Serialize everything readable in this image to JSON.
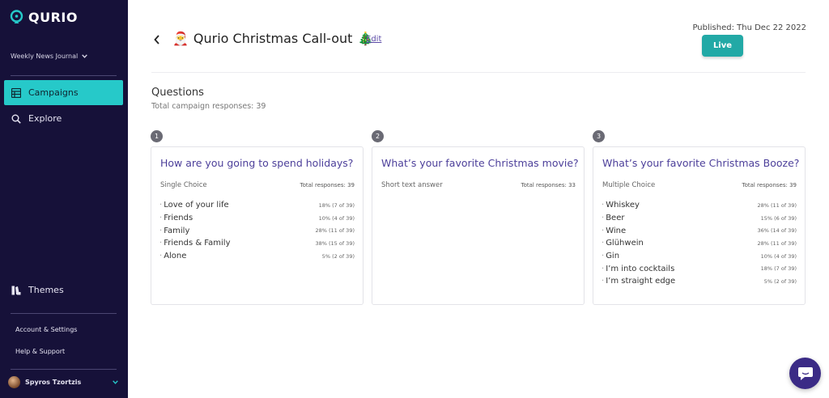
{
  "brand": {
    "name": "QURIO",
    "accent": "#26c9c9",
    "sidebar_bg": "#161139"
  },
  "sidebar": {
    "workspace": "Weekly News Journal",
    "nav": [
      {
        "label": "Campaigns",
        "icon": "table-icon",
        "active": true
      },
      {
        "label": "Explore",
        "icon": "search-icon",
        "active": false
      },
      {
        "label": "Themes",
        "icon": "themes-icon",
        "active": false
      }
    ],
    "account_link": "Account & Settings",
    "help_link": "Help & Support",
    "user_name": "Spyros Tzortzis"
  },
  "header": {
    "title": "Qurio Christmas Call-out",
    "title_prefix_emoji": "🎅",
    "title_suffix_emoji": "🎄",
    "edit_label": "Edit",
    "published": "Published: Thu Dec 22 2022",
    "live_label": "Live"
  },
  "questions": {
    "heading": "Questions",
    "subtitle": "Total campaign responses: 39",
    "cards": [
      {
        "number": "1",
        "title": "How are you going to spend holidays?",
        "type": "Single Choice",
        "total": "Total responses: 39",
        "answers": [
          {
            "label": "Love of your life",
            "pct": "18% (7 of 39)"
          },
          {
            "label": "Friends",
            "pct": "10% (4 of 39)"
          },
          {
            "label": "Family",
            "pct": "28% (11 of 39)"
          },
          {
            "label": "Friends & Family",
            "pct": "38% (15 of 39)"
          },
          {
            "label": "Alone",
            "pct": "5% (2 of 39)"
          }
        ]
      },
      {
        "number": "2",
        "title": "What’s your favorite Christmas movie?",
        "type": "Short text answer",
        "total": "Total responses: 33",
        "answers": []
      },
      {
        "number": "3",
        "title": "What’s your favorite Christmas Booze?",
        "type": "Multiple Choice",
        "total": "Total responses: 39",
        "answers": [
          {
            "label": "Whiskey",
            "pct": "28% (11 of 39)"
          },
          {
            "label": "Beer",
            "pct": "15% (6 of 39)"
          },
          {
            "label": "Wine",
            "pct": "36% (14 of 39)"
          },
          {
            "label": "Glühwein",
            "pct": "28% (11 of 39)"
          },
          {
            "label": "Gin",
            "pct": "10% (4 of 39)"
          },
          {
            "label": "I’m into cocktails",
            "pct": "18% (7 of 39)"
          },
          {
            "label": "I’m straight edge",
            "pct": "5% (2 of 39)"
          }
        ]
      }
    ]
  }
}
